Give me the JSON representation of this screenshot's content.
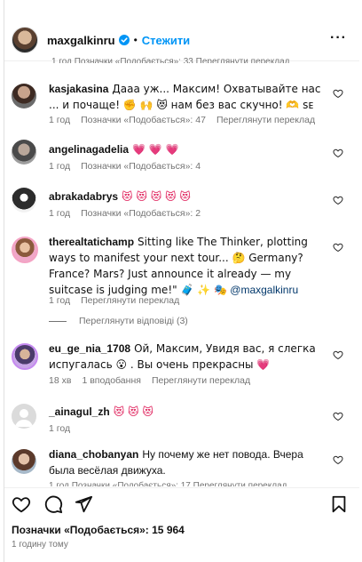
{
  "header": {
    "username": "maxgalkinru",
    "separator": "•",
    "follow_label": "Стежити",
    "more_label": "···"
  },
  "top_cut_meta": "1 год    Позначки «Подобається»: 33    Переглянути переклад",
  "comments": [
    {
      "username": "kasjakasina",
      "text": "Дааа уж... Максим! Охватывайте нас ... и почаще! ✊ 🙌 😻 нам без вас скучно! 🫶 ꜱᴇ",
      "time": "1 год",
      "likes": "Позначки «Подобається»: 47",
      "translate": "Переглянути переклад"
    },
    {
      "username": "angelinagadelia",
      "text": "💗 💗 💗",
      "time": "1 год",
      "likes": "Позначки «Подобається»: 4"
    },
    {
      "username": "abrakadabrys",
      "text": "😻 😻 😻 😻 😻",
      "time": "1 год",
      "likes": "Позначки «Подобається»: 2"
    },
    {
      "username": "therealtatichamp",
      "text": "Sitting like The Thinker, plotting ways to manifest your next tour... 🤔 Germany? France? Mars? Just announce it already — my suitcase is judging me!\" 🧳 ✨ 🎭",
      "mention": "@maxgalkinru",
      "time": "1 год",
      "translate": "Переглянути переклад",
      "replies": "Переглянути відповіді (3)"
    },
    {
      "username": "eu_ge_nia_1708",
      "text": "Ой, Максим, Увидя вас, я слегка испугалась 😮 . Вы очень прекрасны 💗",
      "time": "18 хв",
      "likes": "1 вподобання",
      "translate": "Переглянути переклад"
    },
    {
      "username": "_ainagul_zh",
      "text": "😻 😻 😻",
      "time": "1 год"
    },
    {
      "username": "diana_chobanyan",
      "text": "Ну почему же нет повода. Вчера была весёлая движуха.",
      "time": "",
      "likes": ""
    }
  ],
  "bottom_cut_meta": "1 год    Позначки «Подобається»: 17    Переглянути переклад",
  "footer": {
    "likes": "Позначки «Подобається»: 15 964",
    "posted": "1 годину тому"
  },
  "icons": {
    "like": "heart-icon",
    "comment": "comment-icon",
    "share": "send-icon",
    "save": "bookmark-icon"
  },
  "colors": {
    "link": "#0095f6",
    "mention": "#00376b",
    "meta": "#737373"
  }
}
